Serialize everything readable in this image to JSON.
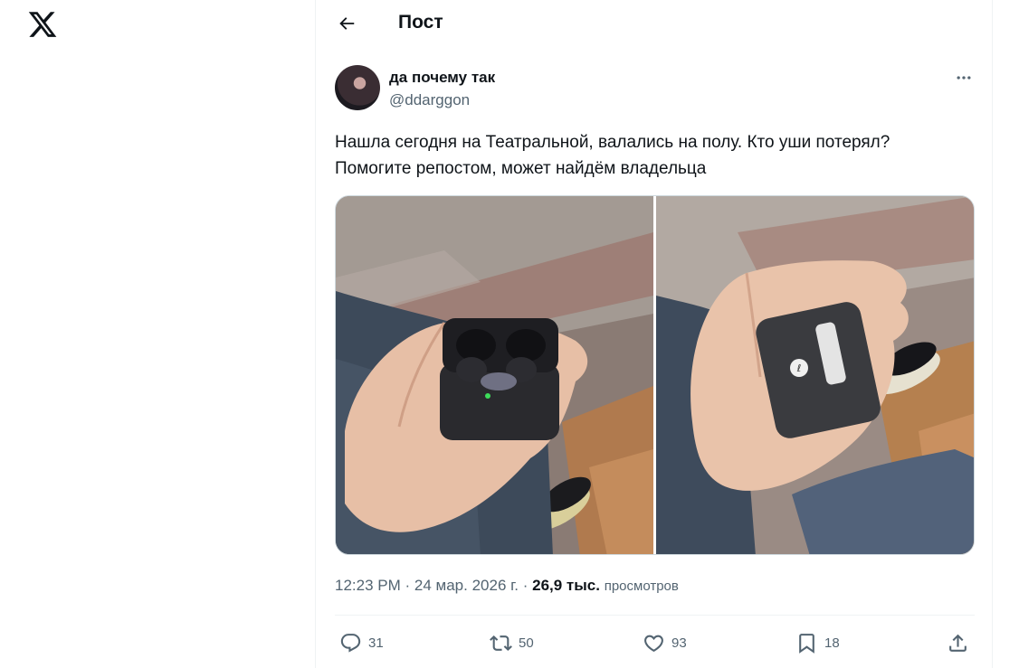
{
  "app": {
    "logo_icon": "x-logo-icon"
  },
  "header": {
    "title": "Пост",
    "back_icon": "arrow-left-icon"
  },
  "post": {
    "author": {
      "display_name": "да почему так",
      "handle": "@ddarggon"
    },
    "more_icon": "more-horizontal-icon",
    "text_lines": [
      "Нашла сегодня на Театральной, валались на полу. Кто уши потерял?",
      "Помогите репостом, может найдём владельца"
    ],
    "media": [
      {
        "description_icon": "photo-earbuds-open-case"
      },
      {
        "description_icon": "photo-earbuds-closed-case"
      }
    ],
    "time": "12:23 PM",
    "date": "24 мар. 2026 г.",
    "separator": "·",
    "views_count": "26,9 тыс.",
    "views_label": "просмотров",
    "actions": {
      "reply": {
        "icon": "reply-icon",
        "count": "31"
      },
      "repost": {
        "icon": "repost-icon",
        "count": "50"
      },
      "like": {
        "icon": "heart-icon",
        "count": "93"
      },
      "bookmark": {
        "icon": "bookmark-icon",
        "count": "18"
      },
      "share": {
        "icon": "share-icon"
      }
    }
  },
  "colors": {
    "text": "#0f1419",
    "secondary": "#536471",
    "border": "#eff3f4"
  }
}
